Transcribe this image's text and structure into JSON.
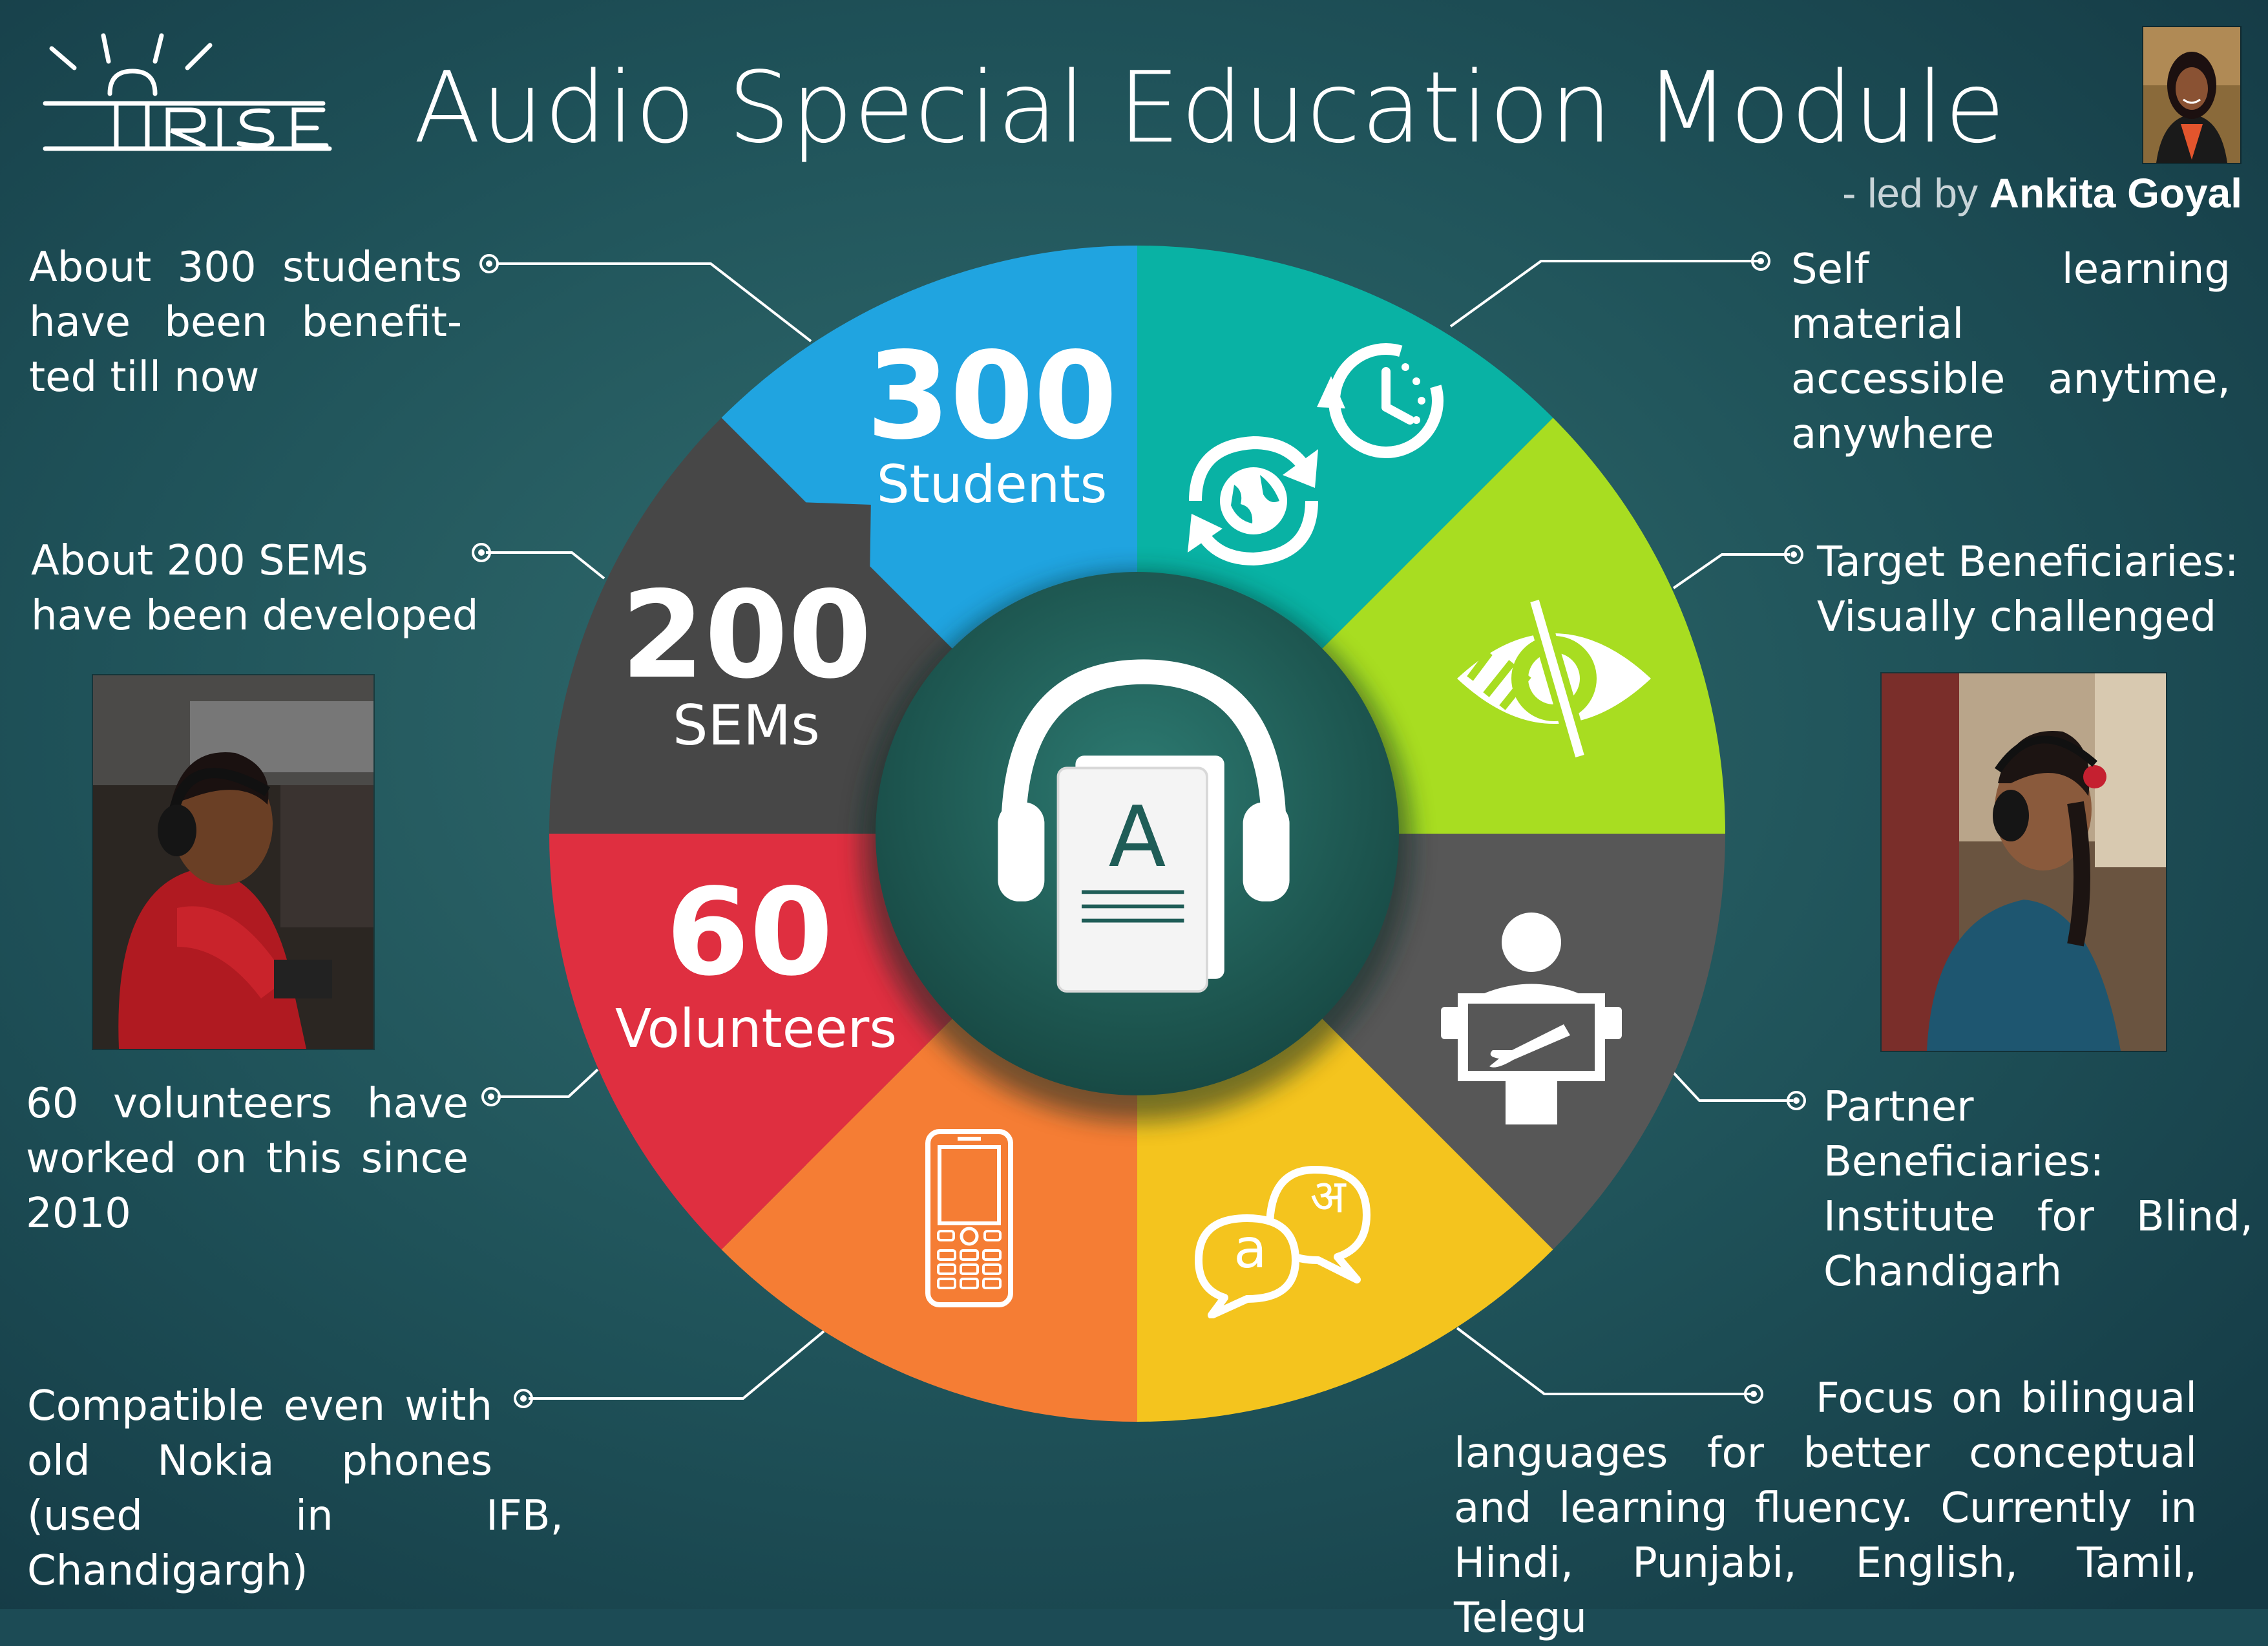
{
  "header": {
    "logo_text": "IRISE",
    "title": "Audio Special Education Module",
    "led_by_prefix": "- led by",
    "led_by_name": "Ankita Goyal"
  },
  "wheel": {
    "segments": [
      {
        "number": "300",
        "label": "Students",
        "color": "#20a4e0"
      },
      {
        "icon": "globe-refresh-clock-icon",
        "color": "#09b2a4"
      },
      {
        "icon": "eye-strike-icon",
        "color": "#a8dd21"
      },
      {
        "icon": "person-braille-board-icon",
        "color": "#575757"
      },
      {
        "icon": "bilingual-speech-icon",
        "color": "#f4c41e"
      },
      {
        "icon": "mobile-phone-icon",
        "color": "#f57d34"
      },
      {
        "number": "60",
        "label": "Volunteers",
        "color": "#df2f40"
      },
      {
        "number": "200",
        "label": "SEMs",
        "color": "#474747"
      }
    ],
    "center_icon": "headphones-book-icon",
    "center_letter": "A",
    "center_color": "#1f5d57",
    "speech_letters": [
      "a",
      "अ"
    ]
  },
  "notes": {
    "students": "About 300 students have been benefit- ted till now",
    "students_lines": [
      "About  300  students",
      "have  been  benefit-",
      "ted till now"
    ],
    "sems_lines": [
      "About 200 SEMs",
      "have  been developed"
    ],
    "volunteers_lines": [
      "60  volunteers  have",
      "worked on this since",
      "2010"
    ],
    "nokia_lines": [
      "Compatible  even  with",
      "old  Nokia  phones",
      "(used in IFB, Chandigargh)"
    ],
    "self_learning_lines": [
      "Self learning material",
      "accessible   anytime,",
      "anywhere"
    ],
    "target_lines": [
      "Target Beneficiaries:",
      "Visually challenged"
    ],
    "partner_lines": [
      "Partner Beneficiaries:",
      "Institute  for  Blind,",
      "Chandigarh"
    ],
    "bilingual_lines": [
      "Focus on bilingual",
      "languages  for  better  conceptual",
      "and  learning  fluency.  Currently  in",
      "Hindi, Punjabi, English, Tamil, Telegu"
    ]
  },
  "colors": {
    "background": "#1c4b55",
    "background_light": "#2f6f72",
    "connector": "#ffffff"
  }
}
